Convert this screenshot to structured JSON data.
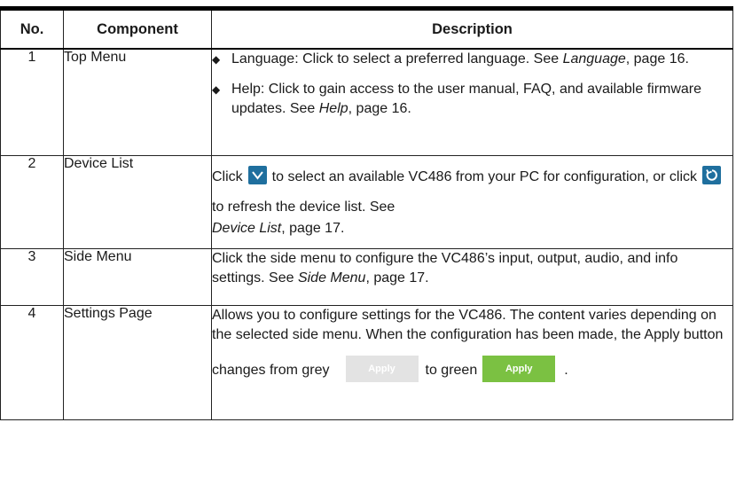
{
  "table": {
    "headers": {
      "no": "No.",
      "component": "Component",
      "description": "Description"
    },
    "rows": [
      {
        "no": "1",
        "component": "Top Menu",
        "bullets": [
          {
            "lead": "Language: Click to select a preferred language. See ",
            "ref": "Language",
            "tail": ", page 16."
          },
          {
            "lead": "Help: Click to gain access to the user manual, FAQ, and available firmware updates. See ",
            "ref": "Help",
            "tail": ", page 16."
          }
        ]
      },
      {
        "no": "2",
        "component": "Device List",
        "part1": "Click",
        "part2": "to select an available VC486 from your PC for configuration, or click",
        "part3": "to refresh the device list. See",
        "ref": "Device List",
        "tail": ", page 17.",
        "icons": [
          "chevron-down-icon",
          "refresh-icon"
        ]
      },
      {
        "no": "3",
        "component": "Side Menu",
        "lead": "Click the side menu to configure the VC486’s input, output, audio, and info settings. See ",
        "ref": "Side Menu",
        "tail": ", page 17."
      },
      {
        "no": "4",
        "component": "Settings Page",
        "text": "Allows you to configure settings for the VC486. The content varies depending on the selected side menu. When the configuration has been made, the Apply button",
        "line_lead": "changes from grey",
        "line_mid": "to green",
        "line_end": ".",
        "apply_label_grey": "Apply",
        "apply_label_green": "Apply"
      }
    ]
  },
  "colors": {
    "icon_blue": "#1f6f9e",
    "apply_grey": "#e3e3e3",
    "apply_green": "#7bc142"
  }
}
